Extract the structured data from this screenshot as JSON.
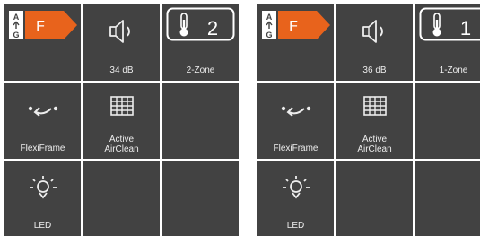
{
  "colors": {
    "tile": "#424242",
    "text": "#ededed",
    "energy_tag": "#e8631c",
    "background": "#ffffff"
  },
  "panels": [
    {
      "energy": {
        "scale_top": "A",
        "scale_bottom": "G",
        "rating": "F",
        "icon": "energy-rating-icon"
      },
      "noise": {
        "label": "34 dB",
        "icon": "speaker-icon"
      },
      "zone": {
        "number": "2",
        "label": "2-Zone",
        "icon": "thermometer-icon"
      },
      "flexiframe": {
        "label": "FlexiFrame",
        "icon": "flexiframe-arrow-icon"
      },
      "airclean": {
        "label": "Active\nAirClean",
        "icon": "air-filter-grid-icon"
      },
      "led": {
        "label": "LED",
        "icon": "light-bulb-icon"
      }
    },
    {
      "energy": {
        "scale_top": "A",
        "scale_bottom": "G",
        "rating": "F",
        "icon": "energy-rating-icon"
      },
      "noise": {
        "label": "36 dB",
        "icon": "speaker-icon"
      },
      "zone": {
        "number": "1",
        "label": "1-Zone",
        "icon": "thermometer-icon"
      },
      "flexiframe": {
        "label": "FlexiFrame",
        "icon": "flexiframe-arrow-icon"
      },
      "airclean": {
        "label": "Active\nAirClean",
        "icon": "air-filter-grid-icon"
      },
      "led": {
        "label": "LED",
        "icon": "light-bulb-icon"
      }
    }
  ]
}
